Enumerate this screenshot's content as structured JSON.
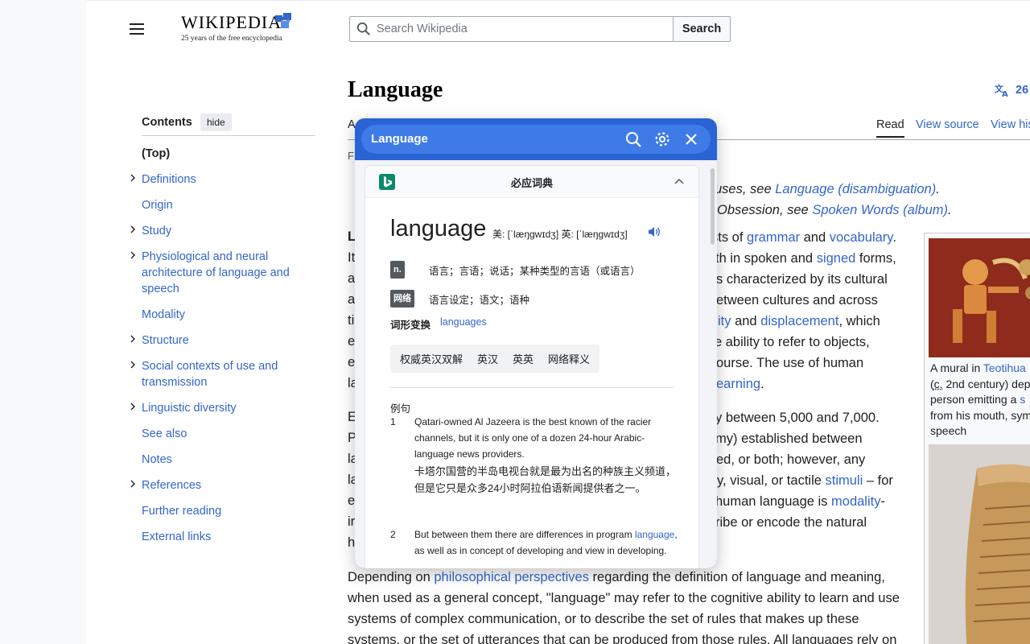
{
  "header": {
    "logo_word": "WIKIPEDIA",
    "logo_tagline": "25 years of the free encyclopedia",
    "search_placeholder": "Search Wikipedia",
    "search_button": "Search"
  },
  "article": {
    "title": "Language",
    "languages_count": "26",
    "tab_article_fragment": "A",
    "tabs": {
      "read": "Read",
      "view_source": "View source",
      "view_history": "View his"
    },
    "from_fragment": "F",
    "hatnote_1": {
      "pre": "uses, see ",
      "link": "Language (disambiguation)",
      "post": "."
    },
    "hatnote_2": {
      "pre": "Obsession, see ",
      "link": "Spoken Words (album)",
      "post": "."
    },
    "p1_right": [
      {
        "pre": "sts of ",
        "link1": "grammar",
        "mid": " and ",
        "link2": "vocabulary",
        "post": "."
      },
      {
        "pre": "th in spoken and ",
        "link1": "signed",
        "post": " forms,"
      },
      {
        "pre": "s characterized by its cultural"
      },
      {
        "pre": "etween cultures and across"
      },
      {
        "link1": "ity",
        "mid": " and ",
        "link2": "displacement",
        "post": ", which"
      },
      {
        "pre": "e ability to refer to objects,"
      },
      {
        "pre": "ourse. The use of human"
      },
      {
        "link1": "earning",
        "post": "."
      }
    ],
    "p1_left": [
      "L",
      "It",
      "a",
      "a",
      "ti",
      "e",
      "e",
      "la"
    ],
    "p2_right": [
      {
        "pre": "y between 5,000 and 7,000."
      },
      {
        "pre": "my) established between"
      },
      {
        "pre": "ed, or both; however, any"
      },
      {
        "pre": "y, visual, or tactile ",
        "link1": "stimuli",
        "post": " – for"
      },
      {
        "pre": "human language is ",
        "link1": "modality",
        "post": "-"
      },
      {
        "pre": "ribe or encode the natural"
      }
    ],
    "p2_left": [
      "E",
      "P",
      "la",
      "la",
      "e",
      "ir",
      "h"
    ],
    "p3": [
      {
        "pre": "Depending on ",
        "link1": "philosophical perspectives",
        "post": " regarding the definition of language and meaning,"
      },
      {
        "pre": "when used as a general concept, \"language\" may refer to the cognitive ability to learn and use"
      },
      {
        "pre": "systems of complex communication, or to describe the set of rules that makes up these"
      },
      {
        "pre": "systems, or the set of utterances that can be produced from those rules. All languages rely on"
      }
    ],
    "caption": [
      {
        "pre": "A mural in ",
        "link": "Teotihua"
      },
      {
        "pre": "(",
        "abbr": "c.",
        "post": " 2nd century) dep"
      },
      {
        "pre": "person emitting a ",
        "link": "s"
      },
      {
        "pre": "from his mouth, sym"
      },
      {
        "pre": "speech"
      }
    ]
  },
  "toc": {
    "title": "Contents",
    "hide": "hide",
    "items": [
      {
        "label": "(Top)",
        "expandable": false,
        "current": true
      },
      {
        "label": "Definitions",
        "expandable": true
      },
      {
        "label": "Origin",
        "expandable": false
      },
      {
        "label": "Study",
        "expandable": true
      },
      {
        "label": "Physiological and neural architecture of language and speech",
        "expandable": true
      },
      {
        "label": "Modality",
        "expandable": false
      },
      {
        "label": "Structure",
        "expandable": true
      },
      {
        "label": "Social contexts of use and transmission",
        "expandable": true
      },
      {
        "label": "Linguistic diversity",
        "expandable": true
      },
      {
        "label": "See also",
        "expandable": false
      },
      {
        "label": "Notes",
        "expandable": false
      },
      {
        "label": "References",
        "expandable": true
      },
      {
        "label": "Further reading",
        "expandable": false
      },
      {
        "label": "External links",
        "expandable": false
      }
    ]
  },
  "popup": {
    "query": "Language",
    "card_title": "必应词典",
    "word": "language",
    "phonetic_us": "美: [ˈlæŋɡwɪdʒ]",
    "phonetic_uk": "英: [ˈlæŋɡwɪdʒ]",
    "pos_noun": "n.",
    "def_noun": "语言；言语；说话；某种类型的言语（或语言）",
    "pos_web": "网络",
    "def_web": "语言设定；语文；语种",
    "forms_label": "词形变换",
    "forms_value": "languages",
    "tabs": [
      "权威英汉双解",
      "英汉",
      "英英",
      "网络释义"
    ],
    "examples_label": "例句",
    "examples": [
      {
        "num": "1",
        "en": "Qatari-owned Al Jazeera is the best known of the racier channels, but it is only one of a dozen 24-hour Arabic-language news providers.",
        "zh": "卡塔尔国营的半岛电视台就是最为出名的种族主义频道，但是它只是众多24小时阿拉伯语新闻提供者之一。"
      },
      {
        "num": "2",
        "en_pre": "But between them there are differences in program ",
        "en_link": "language",
        "en_post": ", as well as in concept of developing and view in developing."
      }
    ]
  }
}
